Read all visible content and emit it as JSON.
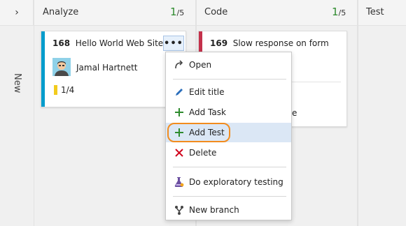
{
  "board": {
    "expand_glyph": "›",
    "new_column_label": "New",
    "columns": [
      {
        "title": "Analyze",
        "count": "1",
        "limit": "/5"
      },
      {
        "title": "Code",
        "count": "1",
        "limit": "/5"
      },
      {
        "title": "Test"
      }
    ]
  },
  "cards": [
    {
      "id": "168",
      "title": "Hello World Web Site",
      "assignee": "Jamal Hartnett",
      "tasks": "1/4",
      "more_label": "•••",
      "color": "#009ccc"
    },
    {
      "id": "169",
      "title": "Slow response on form",
      "partial_text": "e",
      "color": "#c4314b"
    }
  ],
  "menu": {
    "items": [
      {
        "label": "Open",
        "icon": "open-icon"
      },
      {
        "label": "Edit title",
        "icon": "pencil-icon"
      },
      {
        "label": "Add Task",
        "icon": "plus-icon"
      },
      {
        "label": "Add Test",
        "icon": "plus-icon"
      },
      {
        "label": "Delete",
        "icon": "delete-x-icon"
      },
      {
        "label": "Do exploratory testing",
        "icon": "flask-icon"
      },
      {
        "label": "New branch",
        "icon": "branch-icon"
      }
    ]
  },
  "colors": {
    "count_green": "#2e8b2e",
    "highlight": "#dbe7f5",
    "callout_orange": "#f28c1e",
    "plus_green": "#2e8b2e",
    "delete_red": "#d0021b",
    "pencil_blue": "#2a6ebb"
  }
}
